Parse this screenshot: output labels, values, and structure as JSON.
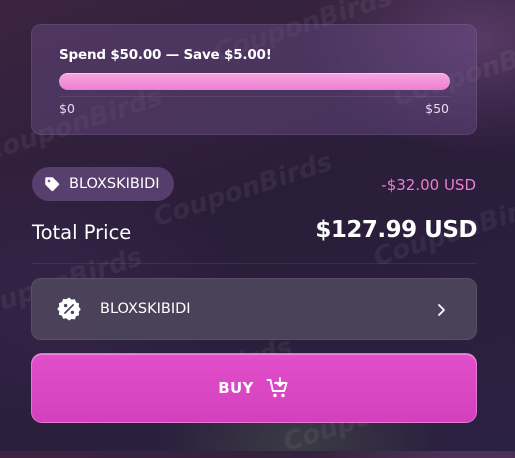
{
  "progress": {
    "title": "Spend $50.00 — Save $5.00!",
    "min_label": "$0",
    "max_label": "$50",
    "fill_fraction": 1.0
  },
  "applied_coupon": {
    "code": "BLOXSKIBIDI",
    "discount": "-$32.00 USD"
  },
  "total": {
    "label": "Total Price",
    "value": "$127.99 USD"
  },
  "coupon_selector": {
    "code": "BLOXSKIBIDI"
  },
  "buy_button": {
    "label": "BUY"
  },
  "watermark": {
    "text": "CouponBirds"
  },
  "colors": {
    "accent": "#d946c3",
    "progress": "#ef87d4",
    "discount": "#ef7ccf"
  },
  "icons": {
    "coupon_chip": "tag-icon",
    "coupon_row": "percent-badge-icon",
    "coupon_row_action": "chevron-right-icon",
    "buy": "cart-add-icon"
  }
}
